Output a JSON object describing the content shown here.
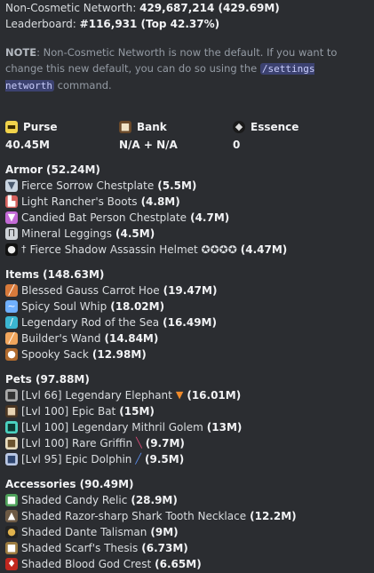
{
  "header": {
    "networth_label": "Non-Cosmetic Networth:",
    "networth_value": "429,687,214 (429.69M)",
    "leaderboard_label": "Leaderboard:",
    "leaderboard_value": "#116,931 (Top 42.37%)"
  },
  "note": {
    "label": "NOTE",
    "text_1": ": Non-Cosmetic Networth is now the default. If you want to change this new default, you can do so using the",
    "command": "/settings networth",
    "text_2": "command."
  },
  "stats": [
    {
      "label": "Purse",
      "value": "40.45M",
      "icon": "purse-icon"
    },
    {
      "label": "Bank",
      "value": "N/A + N/A",
      "icon": "bank-icon"
    },
    {
      "label": "Essence",
      "value": "0",
      "icon": "essence-icon"
    }
  ],
  "sections": {
    "armor": {
      "title": "Armor (52.24M)",
      "items": [
        {
          "name": "Fierce Sorrow Chestplate",
          "value": "(5.5M)"
        },
        {
          "name": "Light Rancher's Boots",
          "value": "(4.8M)"
        },
        {
          "name": "Candied Bat Person Chestplate",
          "value": "(4.7M)"
        },
        {
          "name": "Mineral Leggings",
          "value": "(4.5M)"
        },
        {
          "name": "Fierce Shadow Assassin Helmet ✪✪✪✪",
          "value": "(4.47M)"
        }
      ]
    },
    "items": {
      "title": "Items (148.63M)",
      "items": [
        {
          "name": "Blessed Gauss Carrot Hoe",
          "value": "(19.47M)"
        },
        {
          "name": "Spicy Soul Whip",
          "value": "(18.02M)"
        },
        {
          "name": "Legendary Rod of the Sea",
          "value": "(16.49M)"
        },
        {
          "name": "Builder's Wand",
          "value": "(14.84M)"
        },
        {
          "name": "Spooky Sack",
          "value": "(12.98M)"
        }
      ]
    },
    "pets": {
      "title": "Pets (97.88M)",
      "items": [
        {
          "name": "[Lvl 66] Legendary Elephant",
          "value": "(16.01M)"
        },
        {
          "name": "[Lvl 100] Epic Bat",
          "value": "(15M)"
        },
        {
          "name": "[Lvl 100] Legendary Mithril Golem",
          "value": "(13M)"
        },
        {
          "name": "[Lvl 100] Rare Griffin",
          "value": "(9.7M)"
        },
        {
          "name": "[Lvl 95] Epic Dolphin",
          "value": "(9.5M)"
        }
      ]
    },
    "accessories": {
      "title": "Accessories (90.49M)",
      "items": [
        {
          "name": "Shaded Candy Relic",
          "value": "(28.9M)"
        },
        {
          "name": "Shaded Razor-sharp Shark Tooth Necklace",
          "value": "(12.2M)"
        },
        {
          "name": "Shaded Dante Talisman",
          "value": "(9M)"
        },
        {
          "name": "Shaded Scarf's Thesis",
          "value": "(6.73M)"
        },
        {
          "name": "Shaded Blood God Crest",
          "value": "(6.65M)"
        }
      ]
    }
  }
}
